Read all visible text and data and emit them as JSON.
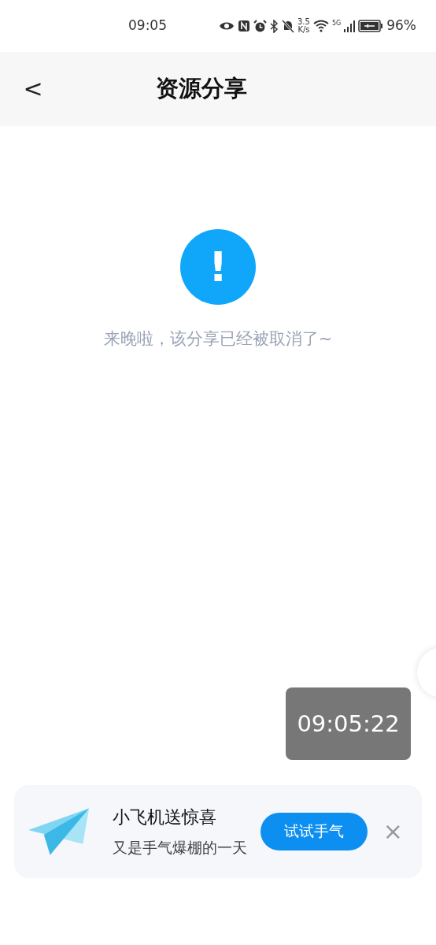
{
  "status_bar": {
    "time": "09:05",
    "speed_value": "3.5",
    "speed_unit": "K/s",
    "network": "5G",
    "battery": "96%"
  },
  "header": {
    "back": "<",
    "title": "资源分享"
  },
  "notice": {
    "icon": "!",
    "message": "来晚啦，该分享已经被取消了~"
  },
  "timer": "09:05:22",
  "banner": {
    "title": "小飞机送惊喜",
    "subtitle": "又是手气爆棚的一天",
    "button": "试试手气",
    "close": "×"
  }
}
